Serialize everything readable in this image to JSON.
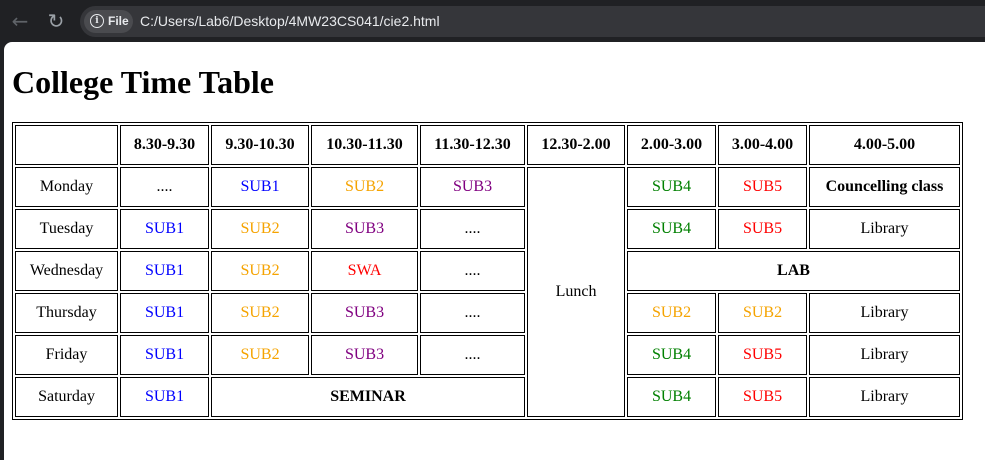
{
  "browser": {
    "url_chip": "File",
    "url": "C:/Users/Lab6/Desktop/4MW23CS041/cie2.html"
  },
  "page": {
    "title": "College Time Table"
  },
  "timetable": {
    "times": [
      "8.30-9.30",
      "9.30-10.30",
      "10.30-11.30",
      "11.30-12.30",
      "12.30-2.00",
      "2.00-3.00",
      "3.00-4.00",
      "4.00-5.00"
    ],
    "lunch": "Lunch",
    "monday": {
      "day": "Monday",
      "p1": "....",
      "p2": "SUB1",
      "p3": "SUB2",
      "p4": "SUB3",
      "p5": "SUB4",
      "p6": "SUB5",
      "p7": "Councelling class"
    },
    "tuesday": {
      "day": "Tuesday",
      "p1": "SUB1",
      "p2": "SUB2",
      "p3": "SUB3",
      "p4": "....",
      "p5": "SUB4",
      "p6": "SUB5",
      "p7": "Library"
    },
    "wednesday": {
      "day": "Wednesday",
      "p1": "SUB1",
      "p2": "SUB2",
      "p3": "SWA",
      "p4": "....",
      "lab": "LAB"
    },
    "thursday": {
      "day": "Thursday",
      "p1": "SUB1",
      "p2": "SUB2",
      "p3": "SUB3",
      "p4": "....",
      "p5": "SUB2",
      "p6": "SUB2",
      "p7": "Library"
    },
    "friday": {
      "day": "Friday",
      "p1": "SUB1",
      "p2": "SUB2",
      "p3": "SUB3",
      "p4": "....",
      "p5": "SUB4",
      "p6": "SUB5",
      "p7": "Library"
    },
    "saturday": {
      "day": "Saturday",
      "p1": "SUB1",
      "seminar": "SEMINAR",
      "p5": "SUB4",
      "p6": "SUB5",
      "p7": "Library"
    }
  },
  "colors": {
    "SUB1": "#0000ff",
    "SUB2": "#f5a300",
    "SUB3": "#800080",
    "SUB4": "#008000",
    "SUB5": "#ff0000",
    "SWA": "#ff0000"
  }
}
